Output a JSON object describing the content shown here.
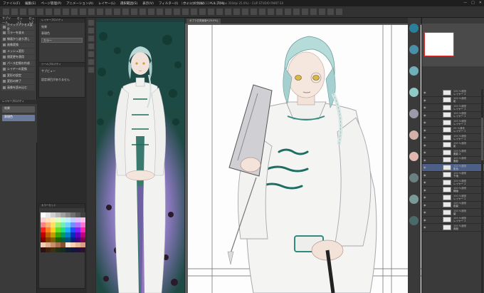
{
  "titlebar": {
    "menu": [
      "ファイル(F)",
      "編集(E)",
      "ページ管理(P)",
      "アニメーション(A)",
      "レイヤー(L)",
      "選択範囲(S)",
      "表示(V)",
      "フィルター(I)",
      "ウィンドウ(W)",
      "ヘルプ(H)"
    ],
    "title": "[ゼブラ白背景版] (1191 x 2000px 350dpi 25.0%) - CLIP STUDIO PAINT EX",
    "buttons": [
      "—",
      "□",
      "✕"
    ]
  },
  "leftpanel": {
    "tabs": [
      "サブツール",
      "セット1",
      "セット2"
    ],
    "items": [
      "クイックアクセス設定",
      "カラーを塗る",
      "線画から塗り潰し",
      "画像変換",
      "メッシュ変形",
      "値変更を適用",
      "パース定規の作成",
      "レイヤーの変換",
      "変形の設定",
      "変形の終了",
      "画像を読み込む"
    ],
    "layer_prop_title": "レイヤープロパティ",
    "layer_prop_items": [
      "効果",
      "表現色"
    ]
  },
  "toolprop": {
    "title": "レイヤープロパティ",
    "label": "効果",
    "sub_label": "表現色",
    "select_value": "カラー"
  },
  "subview": {
    "title": "ツールプロパティ",
    "line1": "サブビュー",
    "line2": "設定項目がありません"
  },
  "colorset": {
    "title": "カラーセット",
    "colors": [
      "#ffffff",
      "#e8e8e8",
      "#d0d0d0",
      "#b8b8b8",
      "#a0a0a0",
      "#888888",
      "#707070",
      "#585858",
      "#404040",
      "#ffd0d0",
      "#ffe0c0",
      "#fff0b0",
      "#e0ffc0",
      "#c0ffe0",
      "#c0f0ff",
      "#c0d0ff",
      "#e0c0ff",
      "#ffc0f0",
      "#ff8080",
      "#ffb070",
      "#ffe060",
      "#a0f070",
      "#70f0b0",
      "#70d0ff",
      "#7090ff",
      "#b070ff",
      "#ff70d0",
      "#ff2020",
      "#ff8020",
      "#ffd020",
      "#60e020",
      "#20e080",
      "#20b0ff",
      "#2050ff",
      "#8020ff",
      "#ff20b0",
      "#c00000",
      "#c06000",
      "#c0a000",
      "#40a000",
      "#00a060",
      "#0080c0",
      "#0030c0",
      "#6000c0",
      "#c00080",
      "#800000",
      "#804000",
      "#806000",
      "#206000",
      "#006040",
      "#005080",
      "#002080",
      "#400080",
      "#800050",
      "#f0d0b0",
      "#e0b090",
      "#c89070",
      "#a87050",
      "#885030",
      "#ffe8d8",
      "#f8d0b8",
      "#e8b898",
      "#d8a080",
      "#301010",
      "#402010",
      "#403010",
      "#203010",
      "#103020",
      "#102030",
      "#101840",
      "#201040",
      "#301030"
    ]
  },
  "canvas": {
    "tab_label": "ゼブラ白背景版*(25.0%)"
  },
  "palette_circles": [
    "#2a7f9a",
    "#4a8fa8",
    "#6fb0b8",
    "#8fc8c4",
    "#9a9aa8",
    "#d4b0a8",
    "#e0b8b0",
    "#6a8080",
    "#7a9a98",
    "#4a6a6a"
  ],
  "layers": [
    {
      "pct": "100 %通常",
      "name": "レイヤー 1"
    },
    {
      "pct": "100 %通常",
      "name": "影"
    },
    {
      "pct": "100 %通常",
      "name": "レイヤー 1"
    },
    {
      "pct": "100 %通常",
      "name": "レイヤー 1"
    },
    {
      "pct": "100 %通常",
      "name": "レイヤー 1"
    },
    {
      "pct": "25 %通常",
      "name": "レイヤー 1"
    },
    {
      "pct": "100 %通常",
      "name": "レイヤー 1"
    },
    {
      "pct": "100 %通常",
      "name": "影"
    },
    {
      "pct": "100 %通常",
      "name": "服影 2"
    },
    {
      "pct": "100 %通常",
      "name": "服影"
    },
    {
      "pct": "100 %通常",
      "name": "肌色",
      "selected": true
    },
    {
      "pct": "100 %通常",
      "name": "下地"
    },
    {
      "pct": "100 %通常",
      "name": "レイヤー 1"
    },
    {
      "pct": "100 %通常",
      "name": "線画"
    },
    {
      "pct": "100 %通常",
      "name": "レイヤー 1"
    },
    {
      "pct": "100 %通常",
      "name": "前髪"
    },
    {
      "pct": "100 %通常",
      "name": "髪"
    },
    {
      "pct": "100 %通常",
      "name": "レイヤー 1"
    },
    {
      "pct": "100 %通常",
      "name": "用紙"
    }
  ]
}
